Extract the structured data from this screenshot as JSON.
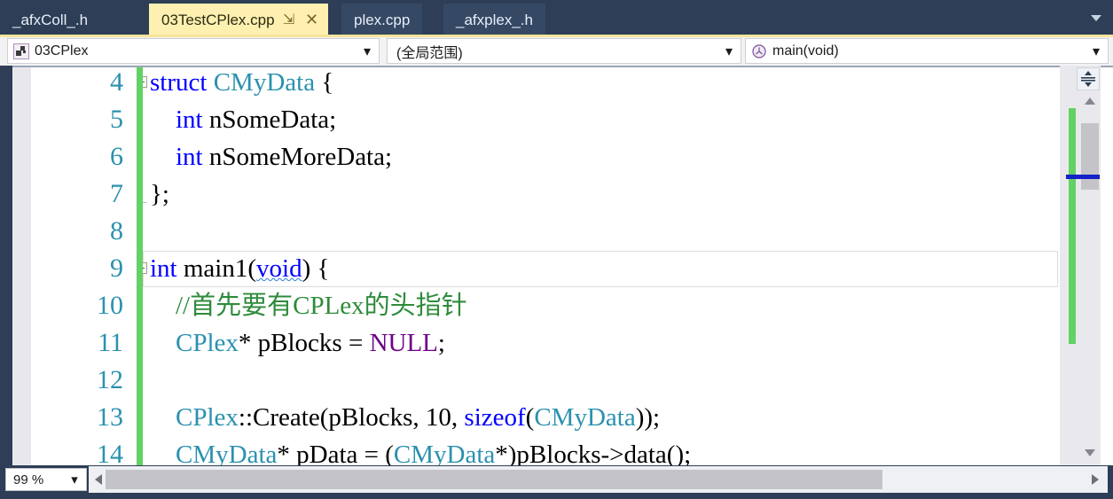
{
  "window": {
    "accent_yellow": "#fdf0b0",
    "chrome_blue": "#2d3e56",
    "change_bar_green": "#63d163"
  },
  "tabbar": {
    "tabs": [
      {
        "label": "_afxColl_.h",
        "active": false
      },
      {
        "label": "03TestCPlex.cpp",
        "active": true
      },
      {
        "label": "plex.cpp",
        "active": false
      },
      {
        "label": "_afxplex_.h",
        "active": false
      }
    ],
    "pin_glyph": "⇲",
    "close_glyph": "✕",
    "overflow_name": "tab-overflow-chevron"
  },
  "navbar": {
    "project": {
      "value": "03CPlex",
      "icon": "project-icon"
    },
    "scope": {
      "value": "(全局范围)",
      "icon": "none"
    },
    "member": {
      "value": "main(void)",
      "icon": "method-icon"
    },
    "arrow_glyph": "▾"
  },
  "editor": {
    "lines": [
      {
        "number": "4",
        "fold": true,
        "current": false,
        "tokens": [
          {
            "t": "struct ",
            "c": "kw"
          },
          {
            "t": "CMyData ",
            "c": "type"
          },
          {
            "t": "{",
            "c": "plain"
          }
        ]
      },
      {
        "number": "5",
        "fold": false,
        "current": false,
        "tokens": [
          {
            "t": "    ",
            "c": "plain"
          },
          {
            "t": "int",
            "c": "kw"
          },
          {
            "t": " nSomeData;",
            "c": "plain"
          }
        ]
      },
      {
        "number": "6",
        "fold": false,
        "current": false,
        "tokens": [
          {
            "t": "    ",
            "c": "plain"
          },
          {
            "t": "int",
            "c": "kw"
          },
          {
            "t": " nSomeMoreData;",
            "c": "plain"
          }
        ]
      },
      {
        "number": "7",
        "fold": false,
        "current": false,
        "tokens": [
          {
            "t": "};",
            "c": "plain"
          }
        ]
      },
      {
        "number": "8",
        "fold": false,
        "current": false,
        "tokens": []
      },
      {
        "number": "9",
        "fold": true,
        "current": true,
        "tokens": [
          {
            "t": "int",
            "c": "kw"
          },
          {
            "t": " main1(",
            "c": "plain"
          },
          {
            "t": "void",
            "c": "kw squiggle"
          },
          {
            "t": ") {",
            "c": "plain"
          }
        ]
      },
      {
        "number": "10",
        "fold": false,
        "current": false,
        "tokens": [
          {
            "t": "    //首先要有CPLex的头指针",
            "c": "comment"
          }
        ]
      },
      {
        "number": "11",
        "fold": false,
        "current": false,
        "tokens": [
          {
            "t": "    ",
            "c": "plain"
          },
          {
            "t": "CPlex",
            "c": "type"
          },
          {
            "t": "* pBlocks = ",
            "c": "plain"
          },
          {
            "t": "NULL",
            "c": "macro"
          },
          {
            "t": ";",
            "c": "plain"
          }
        ]
      },
      {
        "number": "12",
        "fold": false,
        "current": false,
        "tokens": []
      },
      {
        "number": "13",
        "fold": false,
        "current": false,
        "tokens": [
          {
            "t": "    ",
            "c": "plain"
          },
          {
            "t": "CPlex",
            "c": "type"
          },
          {
            "t": "::Create(pBlocks, 10, ",
            "c": "plain"
          },
          {
            "t": "sizeof",
            "c": "kw"
          },
          {
            "t": "(",
            "c": "plain"
          },
          {
            "t": "CMyData",
            "c": "type"
          },
          {
            "t": "));",
            "c": "plain"
          }
        ]
      },
      {
        "number": "14",
        "fold": false,
        "current": false,
        "tokens": [
          {
            "t": "    ",
            "c": "plain"
          },
          {
            "t": "CMyData",
            "c": "type"
          },
          {
            "t": "* pData = (",
            "c": "plain"
          },
          {
            "t": "CMyData",
            "c": "type"
          },
          {
            "t": "*)pBlocks->data();",
            "c": "plain"
          }
        ]
      }
    ]
  },
  "statusbar": {
    "zoom": "99 %",
    "zoom_arrow": "▾"
  }
}
